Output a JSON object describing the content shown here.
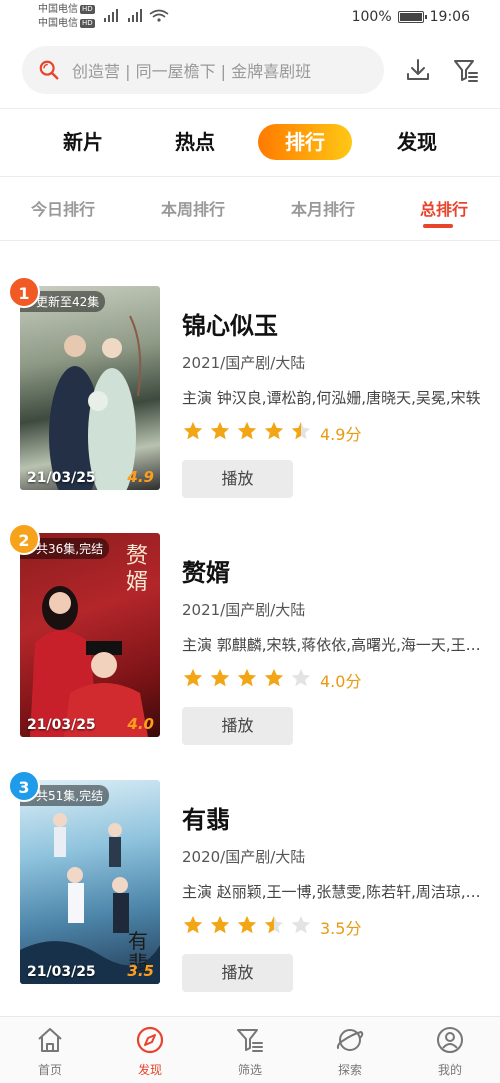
{
  "status_bar": {
    "carrier1": "中国电信",
    "carrier2": "中国电信",
    "hd": "HD",
    "battery": "100%",
    "time": "19:06"
  },
  "header": {
    "search_placeholder": "创造营 | 同一屋檐下 | 金牌喜剧班",
    "icons": [
      "search-icon",
      "download-icon",
      "filter-icon"
    ]
  },
  "top_tabs": [
    "新片",
    "热点",
    "排行",
    "发现"
  ],
  "top_tabs_active": "排行",
  "sub_tabs": [
    "今日排行",
    "本周排行",
    "本月排行",
    "总排行"
  ],
  "sub_tabs_active": "总排行",
  "items": [
    {
      "rank": "1",
      "rank_color": "#f15a24",
      "episode": "更新至42集",
      "date": "21/03/25",
      "poster_score": "4.9",
      "title": "锦心似玉",
      "meta": "2021/国产剧/大陆",
      "cast": "主演 钟汉良,谭松韵,何泓姗,唐晓天,吴冕,宋轶",
      "stars": 4.5,
      "rating": "4.9分",
      "play": "播放"
    },
    {
      "rank": "2",
      "rank_color": "#f7a21b",
      "episode": "共36集,完结",
      "date": "21/03/25",
      "poster_score": "4.0",
      "title": "赘婿",
      "meta": "2021/国产剧/大陆",
      "cast": "主演 郭麒麟,宋轶,蒋依依,高曙光,海一天,王诗龄",
      "stars": 4,
      "rating": "4.0分",
      "play": "播放"
    },
    {
      "rank": "3",
      "rank_color": "#1e9be9",
      "episode": "共51集,完结",
      "date": "21/03/25",
      "poster_score": "3.5",
      "title": "有翡",
      "meta": "2020/国产剧/大陆",
      "cast": "主演 赵丽颖,王一博,张慧雯,陈若轩,周洁琼,孟子义",
      "stars": 3.5,
      "rating": "3.5分",
      "play": "播放"
    }
  ],
  "colors": {
    "accent": "#e8432c",
    "star": "#f2a515",
    "star_empty": "#e3e3e3",
    "tab_gradient_start": "#ff7a00",
    "tab_gradient_end": "#ffc814"
  },
  "bottom_nav": [
    {
      "label": "首页",
      "icon": "home-icon"
    },
    {
      "label": "发现",
      "icon": "compass-icon"
    },
    {
      "label": "筛选",
      "icon": "filter-icon"
    },
    {
      "label": "探索",
      "icon": "planet-icon"
    },
    {
      "label": "我的",
      "icon": "user-icon"
    }
  ],
  "bottom_nav_active": "发现"
}
